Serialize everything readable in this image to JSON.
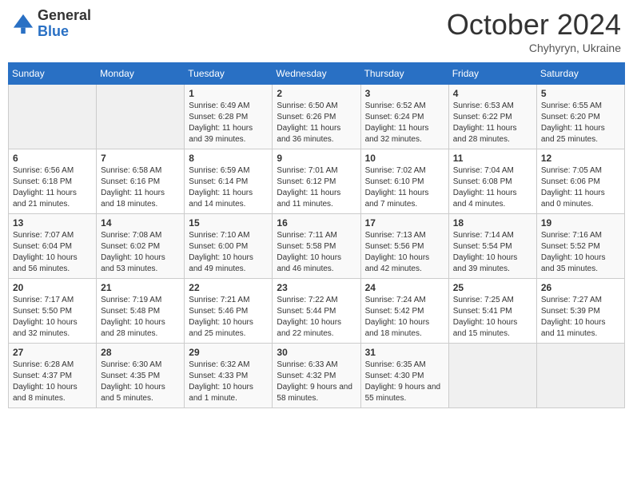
{
  "logo": {
    "general": "General",
    "blue": "Blue"
  },
  "title": "October 2024",
  "subtitle": "Chyhyryn, Ukraine",
  "days_header": [
    "Sunday",
    "Monday",
    "Tuesday",
    "Wednesday",
    "Thursday",
    "Friday",
    "Saturday"
  ],
  "weeks": [
    [
      {
        "day": "",
        "info": ""
      },
      {
        "day": "",
        "info": ""
      },
      {
        "day": "1",
        "info": "Sunrise: 6:49 AM\nSunset: 6:28 PM\nDaylight: 11 hours and 39 minutes."
      },
      {
        "day": "2",
        "info": "Sunrise: 6:50 AM\nSunset: 6:26 PM\nDaylight: 11 hours and 36 minutes."
      },
      {
        "day": "3",
        "info": "Sunrise: 6:52 AM\nSunset: 6:24 PM\nDaylight: 11 hours and 32 minutes."
      },
      {
        "day": "4",
        "info": "Sunrise: 6:53 AM\nSunset: 6:22 PM\nDaylight: 11 hours and 28 minutes."
      },
      {
        "day": "5",
        "info": "Sunrise: 6:55 AM\nSunset: 6:20 PM\nDaylight: 11 hours and 25 minutes."
      }
    ],
    [
      {
        "day": "6",
        "info": "Sunrise: 6:56 AM\nSunset: 6:18 PM\nDaylight: 11 hours and 21 minutes."
      },
      {
        "day": "7",
        "info": "Sunrise: 6:58 AM\nSunset: 6:16 PM\nDaylight: 11 hours and 18 minutes."
      },
      {
        "day": "8",
        "info": "Sunrise: 6:59 AM\nSunset: 6:14 PM\nDaylight: 11 hours and 14 minutes."
      },
      {
        "day": "9",
        "info": "Sunrise: 7:01 AM\nSunset: 6:12 PM\nDaylight: 11 hours and 11 minutes."
      },
      {
        "day": "10",
        "info": "Sunrise: 7:02 AM\nSunset: 6:10 PM\nDaylight: 11 hours and 7 minutes."
      },
      {
        "day": "11",
        "info": "Sunrise: 7:04 AM\nSunset: 6:08 PM\nDaylight: 11 hours and 4 minutes."
      },
      {
        "day": "12",
        "info": "Sunrise: 7:05 AM\nSunset: 6:06 PM\nDaylight: 11 hours and 0 minutes."
      }
    ],
    [
      {
        "day": "13",
        "info": "Sunrise: 7:07 AM\nSunset: 6:04 PM\nDaylight: 10 hours and 56 minutes."
      },
      {
        "day": "14",
        "info": "Sunrise: 7:08 AM\nSunset: 6:02 PM\nDaylight: 10 hours and 53 minutes."
      },
      {
        "day": "15",
        "info": "Sunrise: 7:10 AM\nSunset: 6:00 PM\nDaylight: 10 hours and 49 minutes."
      },
      {
        "day": "16",
        "info": "Sunrise: 7:11 AM\nSunset: 5:58 PM\nDaylight: 10 hours and 46 minutes."
      },
      {
        "day": "17",
        "info": "Sunrise: 7:13 AM\nSunset: 5:56 PM\nDaylight: 10 hours and 42 minutes."
      },
      {
        "day": "18",
        "info": "Sunrise: 7:14 AM\nSunset: 5:54 PM\nDaylight: 10 hours and 39 minutes."
      },
      {
        "day": "19",
        "info": "Sunrise: 7:16 AM\nSunset: 5:52 PM\nDaylight: 10 hours and 35 minutes."
      }
    ],
    [
      {
        "day": "20",
        "info": "Sunrise: 7:17 AM\nSunset: 5:50 PM\nDaylight: 10 hours and 32 minutes."
      },
      {
        "day": "21",
        "info": "Sunrise: 7:19 AM\nSunset: 5:48 PM\nDaylight: 10 hours and 28 minutes."
      },
      {
        "day": "22",
        "info": "Sunrise: 7:21 AM\nSunset: 5:46 PM\nDaylight: 10 hours and 25 minutes."
      },
      {
        "day": "23",
        "info": "Sunrise: 7:22 AM\nSunset: 5:44 PM\nDaylight: 10 hours and 22 minutes."
      },
      {
        "day": "24",
        "info": "Sunrise: 7:24 AM\nSunset: 5:42 PM\nDaylight: 10 hours and 18 minutes."
      },
      {
        "day": "25",
        "info": "Sunrise: 7:25 AM\nSunset: 5:41 PM\nDaylight: 10 hours and 15 minutes."
      },
      {
        "day": "26",
        "info": "Sunrise: 7:27 AM\nSunset: 5:39 PM\nDaylight: 10 hours and 11 minutes."
      }
    ],
    [
      {
        "day": "27",
        "info": "Sunrise: 6:28 AM\nSunset: 4:37 PM\nDaylight: 10 hours and 8 minutes."
      },
      {
        "day": "28",
        "info": "Sunrise: 6:30 AM\nSunset: 4:35 PM\nDaylight: 10 hours and 5 minutes."
      },
      {
        "day": "29",
        "info": "Sunrise: 6:32 AM\nSunset: 4:33 PM\nDaylight: 10 hours and 1 minute."
      },
      {
        "day": "30",
        "info": "Sunrise: 6:33 AM\nSunset: 4:32 PM\nDaylight: 9 hours and 58 minutes."
      },
      {
        "day": "31",
        "info": "Sunrise: 6:35 AM\nSunset: 4:30 PM\nDaylight: 9 hours and 55 minutes."
      },
      {
        "day": "",
        "info": ""
      },
      {
        "day": "",
        "info": ""
      }
    ]
  ]
}
